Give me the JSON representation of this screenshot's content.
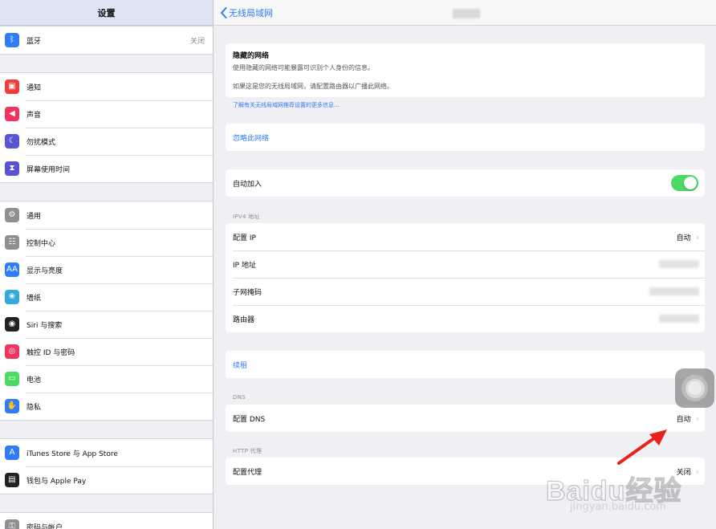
{
  "sidebar": {
    "title": "设置",
    "groups": [
      [
        {
          "label": "蓝牙",
          "value": "关闭",
          "icon": "bluetooth-icon",
          "color": "#2f7cf6"
        }
      ],
      [
        {
          "label": "通知",
          "icon": "notifications-icon",
          "color": "#f23b3b"
        },
        {
          "label": "声音",
          "icon": "sounds-icon",
          "color": "#f2335c"
        },
        {
          "label": "勿扰模式",
          "icon": "moon-icon",
          "color": "#5b52d6"
        },
        {
          "label": "屏幕使用时间",
          "icon": "hourglass-icon",
          "color": "#5b52d6"
        }
      ],
      [
        {
          "label": "通用",
          "icon": "gear-icon",
          "color": "#8e8e93"
        },
        {
          "label": "控制中心",
          "icon": "control-center-icon",
          "color": "#8e8e93"
        },
        {
          "label": "显示与亮度",
          "icon": "display-icon",
          "color": "#2f7cf6"
        },
        {
          "label": "墙纸",
          "icon": "wallpaper-icon",
          "color": "#34aadc"
        },
        {
          "label": "Siri 与搜索",
          "icon": "siri-icon",
          "color": "#222"
        },
        {
          "label": "触控 ID 与密码",
          "icon": "fingerprint-icon",
          "color": "#f2335c"
        },
        {
          "label": "电池",
          "icon": "battery-icon",
          "color": "#4cd964"
        },
        {
          "label": "隐私",
          "icon": "hand-icon",
          "color": "#2f7cf6"
        }
      ],
      [
        {
          "label": "iTunes Store 与 App Store",
          "icon": "app-store-icon",
          "color": "#2f7cf6"
        },
        {
          "label": "钱包与 Apple Pay",
          "icon": "wallet-icon",
          "color": "#222"
        }
      ],
      [
        {
          "label": "密码与帐户",
          "icon": "key-icon",
          "color": "#8e8e93"
        }
      ]
    ]
  },
  "nav": {
    "back_label": "无线局域网"
  },
  "hidden": {
    "title": "隐藏的网络",
    "line1": "使用隐藏的网络可能暴露可识别个人身份的信息。",
    "line2": "如果这是您的无线局域网，请配置路由器以广播此网络。",
    "link": "了解有关无线局域网推荐设置的更多信息..."
  },
  "forget": "忽略此网络",
  "auto_join": {
    "label": "自动加入",
    "on": true
  },
  "ipv4": {
    "header": "IPV4 地址",
    "configure_ip": {
      "label": "配置 IP",
      "value": "自动"
    },
    "ip_address": "IP 地址",
    "subnet": "子网掩码",
    "router": "路由器"
  },
  "renew": "续租",
  "dns": {
    "header": "DNS",
    "label": "配置 DNS",
    "value": "自动"
  },
  "proxy": {
    "header": "HTTP 代理",
    "label": "配置代理",
    "value": "关闭"
  },
  "watermark": {
    "text": "Baidu经验",
    "sub": "jingyan.baidu.com"
  },
  "accent": "#2f7cf6",
  "toggle_color": "#4cd964",
  "arrow_color": "#e8231c"
}
